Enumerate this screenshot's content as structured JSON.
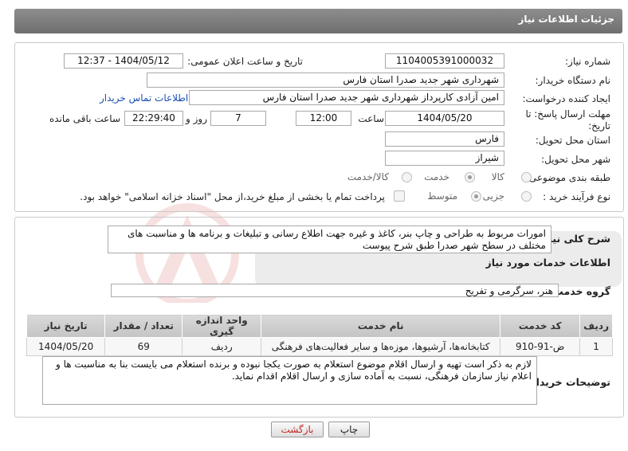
{
  "header": {
    "title": "جزئیات اطلاعات نیاز"
  },
  "form": {
    "need_number_label": "شماره نیاز:",
    "need_number": "1104005391000032",
    "announce_label": "تاریخ و ساعت اعلان عمومی:",
    "announce_value": "1404/05/12 - 12:37",
    "buyer_org_label": "نام دستگاه خریدار:",
    "buyer_org": "شهرداری شهر جدید صدرا استان فارس",
    "creator_label": "ایجاد کننده درخواست:",
    "creator": "امین آزادی کارپرداز شهرداری شهر جدید صدرا استان فارس",
    "contact_link": "اطلاعات تماس خریدار",
    "deadline_label": "مهلت ارسال پاسخ: تا تاریخ:",
    "deadline_date": "1404/05/20",
    "time_label": "ساعت",
    "deadline_time": "12:00",
    "days_value": "7",
    "days_label": "روز و",
    "remaining_time": "22:29:40",
    "remaining_label": "ساعت باقی مانده",
    "province_label": "استان محل تحویل:",
    "province": "فارس",
    "city_label": "شهر محل تحویل:",
    "city": "شیراز",
    "category_label": "طبقه بندی موضوعی:",
    "category_options": [
      "کالا",
      "خدمت",
      "کالا/خدمت"
    ],
    "category_selected": "خدمت",
    "process_label": "نوع فرآیند خرید :",
    "process_options": [
      "جزیی",
      "متوسط"
    ],
    "process_selected": "متوسط",
    "payment_note": "پرداخت تمام یا بخشی از مبلغ خرید،از محل \"اسناد خزانه اسلامی\" خواهد بود."
  },
  "summary": {
    "label": "شرح کلی نیاز:",
    "text": "امورات مربوط به طراحی و چاپ بنر، کاغذ و غیره جهت اطلاع رسانی و تبلیغات و برنامه ها و مناسبت های مختلف در سطح شهر صدرا طبق شرح پیوست"
  },
  "services": {
    "section_title": "اطلاعات خدمات مورد نیاز",
    "group_label": "گروه خدمت:",
    "group_value": "هنر، سرگرمی و تفریح",
    "columns": [
      "ردیف",
      "کد خدمت",
      "نام خدمت",
      "واحد اندازه گیری",
      "تعداد / مقدار",
      "تاریخ نیاز"
    ],
    "rows": [
      [
        "1",
        "ض-91-910",
        "کتابخانه‌ها، آرشیوها، موزه‌ها و سایر فعالیت‌های فرهنگی",
        "ردیف",
        "69",
        "1404/05/20"
      ]
    ]
  },
  "notes": {
    "label": "توضیحات خریدار:",
    "text": "لازم به ذکر است تهیه و ارسال اقلام موضوع استعلام به صورت یکجا نبوده و برنده استعلام می بایست بنا به مناسبت ها و اعلام نیاز سازمان فرهنگی، نسبت به آماده سازی و ارسال اقلام اقدام نماید."
  },
  "buttons": {
    "print": "چاپ",
    "back": "بازگشت"
  },
  "colors": {
    "header_bg": "#7e7e7e",
    "link": "#1a4fb5",
    "back_text": "#c62828"
  }
}
